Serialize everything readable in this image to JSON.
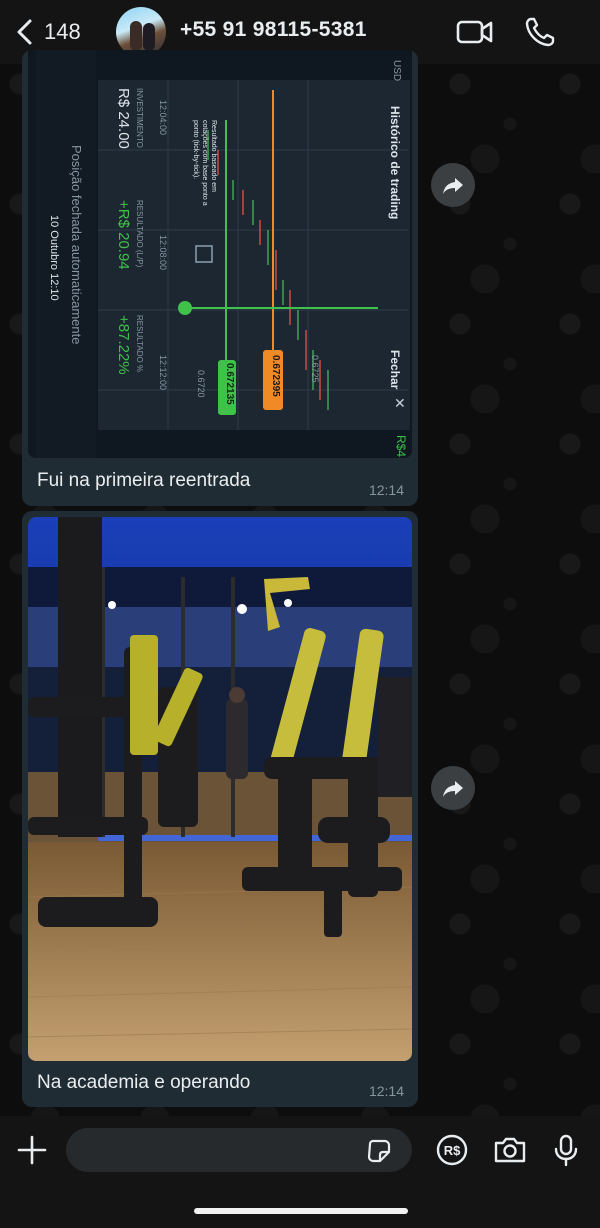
{
  "header": {
    "back_count": "148",
    "contact_name": "+55 91 98115-5381"
  },
  "messages": [
    {
      "type": "image",
      "image_desc": "trading-screenshot",
      "caption": "Fui na primeira reentrada",
      "time": "12:14",
      "trading": {
        "title": "Histórico de trading",
        "close_label": "Fechar",
        "currency": "USD",
        "invest_label": "INVESTIMENTO",
        "invest_value": "R$ 24.00",
        "result_label": "RESULTADO (L/P)",
        "result_value": "+R$ 20.94",
        "result_pct_label": "RESULTADO %",
        "result_pct_value": "+87.22%",
        "closed_text": "Posição fechada automaticamente",
        "date_text": "10 Outubro 12:10",
        "note_text": "Resultado baseado em cotações com base ponto a ponto (tick-by-tick).",
        "price_current": "0.672395",
        "price_entry": "0.672135",
        "axis_ticks": [
          "0.6725",
          "0.6720"
        ],
        "time_ticks": [
          "12:04:00",
          "12:08:00",
          "12:12:00"
        ],
        "right_value": "R$4"
      }
    },
    {
      "type": "image",
      "image_desc": "gym-photo",
      "caption": "Na academia e operando",
      "time": "12:14"
    }
  ],
  "composer": {
    "placeholder": ""
  },
  "colors": {
    "header_bg": "#141414",
    "bubble_bg": "#202c33",
    "accent_green": "#25d366"
  }
}
